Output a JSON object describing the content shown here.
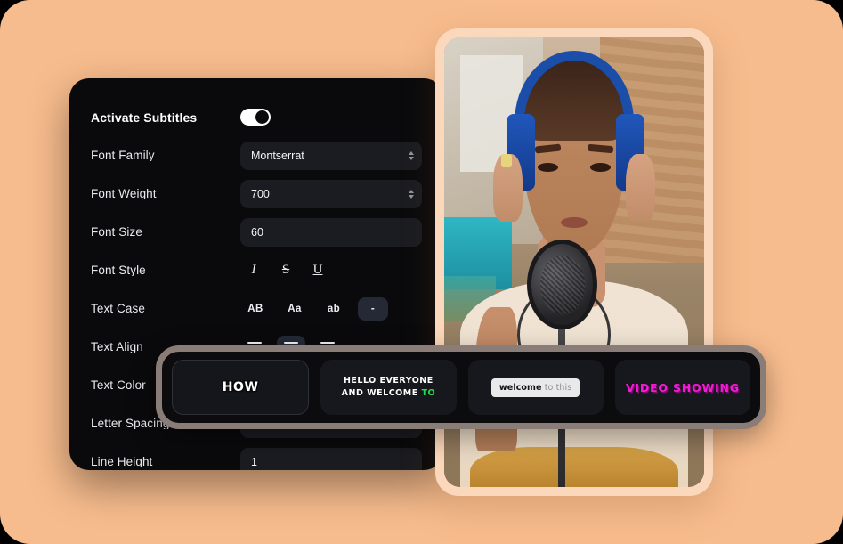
{
  "theme": {
    "page_background": "#000000",
    "backdrop": "#f7bc8d",
    "panel_background": "#0a0a0c",
    "field_background": "#1b1c21",
    "active_pill": "#252936",
    "strip_border": "#8a7d77",
    "video_frame": "#fbd8bb",
    "accent_green": "#22dd4e",
    "accent_magenta": "#f51ad6"
  },
  "settings_panel": {
    "activate_subtitles": {
      "label": "Activate Subtitles",
      "toggle_state": "on"
    },
    "rows": [
      {
        "label": "Font Family",
        "type": "select",
        "value": "Montserrat"
      },
      {
        "label": "Font Weight",
        "type": "select",
        "value": "700"
      },
      {
        "label": "Font Size",
        "type": "input",
        "value": "60"
      }
    ],
    "font_style": {
      "label": "Font Style",
      "options": [
        {
          "name": "italic-button",
          "glyph": "I",
          "active": false
        },
        {
          "name": "strikethrough-button",
          "glyph": "S",
          "active": false
        },
        {
          "name": "underline-button",
          "glyph": "U",
          "active": false
        }
      ]
    },
    "text_case": {
      "label": "Text Case",
      "options": [
        {
          "name": "uppercase-button",
          "label": "AB",
          "active": false
        },
        {
          "name": "titlecase-button",
          "label": "Aa",
          "active": false
        },
        {
          "name": "lowercase-button",
          "label": "ab",
          "active": false
        },
        {
          "name": "nocase-button",
          "label": "-",
          "active": true
        }
      ]
    },
    "text_align": {
      "label": "Text Align",
      "options": [
        {
          "name": "align-left-button",
          "active": false
        },
        {
          "name": "align-center-button",
          "active": true
        },
        {
          "name": "align-right-button",
          "active": false
        }
      ]
    },
    "text_color": {
      "label": "Text Color",
      "value": "#ffffff"
    },
    "letter_spacing": {
      "label": "Letter Spacing"
    },
    "line_height": {
      "label": "Line Height",
      "value": "1"
    }
  },
  "subtitle_styles": {
    "cards": [
      {
        "name": "style-card-how",
        "selected": true,
        "text": "HOW",
        "style": "outlined-bold-white"
      },
      {
        "name": "style-card-hello-everyone",
        "selected": false,
        "line1": "HELLO EVERYONE",
        "line2_main": "AND WELCOME",
        "line2_accent": "TO",
        "style": "two-line-green-accent"
      },
      {
        "name": "style-card-welcome-to-this",
        "selected": false,
        "chip_bold": "welcome",
        "chip_muted": "to this",
        "style": "light-chip-background"
      },
      {
        "name": "style-card-video-showing",
        "selected": false,
        "text": "VIDEO SHOWING",
        "style": "magenta-shadow-bold"
      }
    ]
  },
  "video_preview": {
    "name": "video-preview-card",
    "description": "Woman wearing blue over-ear headphones in front of a studio microphone"
  }
}
